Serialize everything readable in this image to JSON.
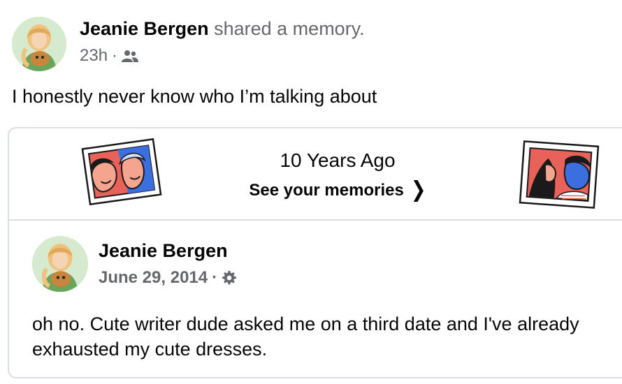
{
  "post": {
    "author_name": "Jeanie Bergen",
    "action_text": "shared a memory.",
    "time": "23h",
    "separator": "·",
    "audience_icon": "friends-icon",
    "text": "I honestly never know who I’m talking about"
  },
  "memory_banner": {
    "title": "10 Years Ago",
    "link_label": "See your memories",
    "chevron_icon": "chevron-right-icon"
  },
  "memory_post": {
    "author_name": "Jeanie Bergen",
    "date": "June 29, 2014",
    "separator": "·",
    "audience_icon": "gear-icon",
    "text": "oh no. Cute writer dude asked me on a third date and I've already exhausted my cute dresses."
  },
  "colors": {
    "text_primary": "#050505",
    "text_secondary": "#65676b",
    "border": "#dadde1",
    "illustration_red": "#e8625a",
    "illustration_blue": "#3b6fe0"
  }
}
